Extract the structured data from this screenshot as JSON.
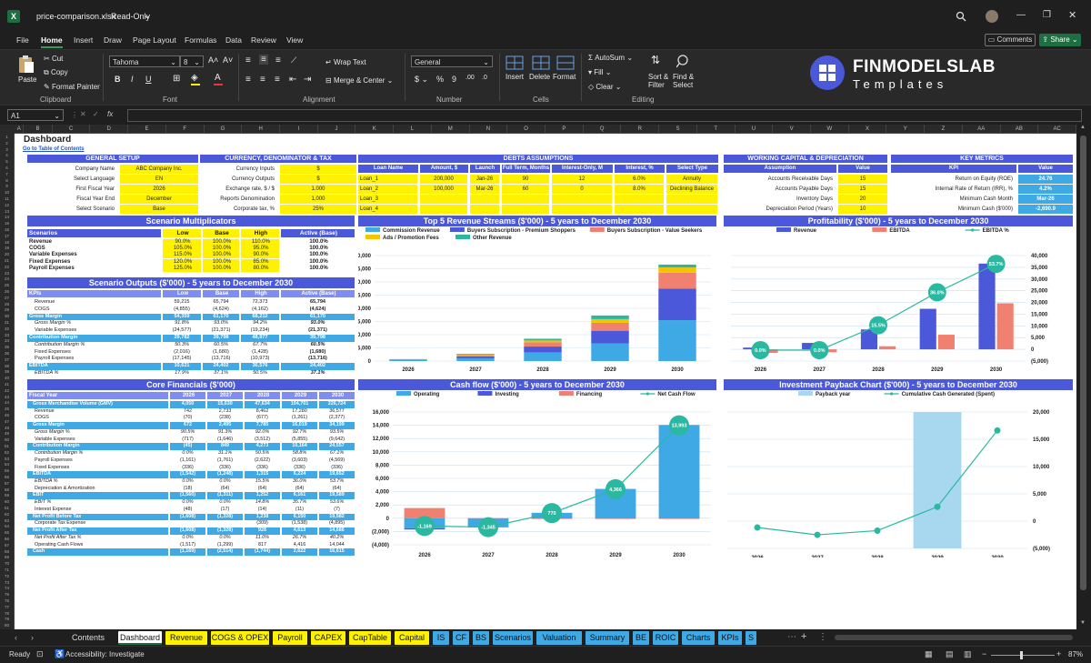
{
  "window": {
    "filename": "price-comparison.xlsx",
    "mode": "Read-Only"
  },
  "menu": [
    "File",
    "Home",
    "Insert",
    "Draw",
    "Page Layout",
    "Formulas",
    "Data",
    "Review",
    "View"
  ],
  "menu_active": "Home",
  "comments_label": "Comments",
  "share_label": "Share",
  "ribbon": {
    "paste": "Paste",
    "cut": "Cut",
    "copy": "Copy",
    "format_painter": "Format Painter",
    "clipboard": "Clipboard",
    "font_name": "Tahoma",
    "font_size": "8",
    "font_group": "Font",
    "wrap_text": "Wrap Text",
    "merge_center": "Merge & Center",
    "alignment": "Alignment",
    "number_format": "General",
    "number_group": "Number",
    "insert": "Insert",
    "delete": "Delete",
    "format": "Format",
    "cells": "Cells",
    "autosum": "AutoSum",
    "fill": "Fill",
    "clear": "Clear",
    "sort_filter": "Sort &\nFilter",
    "find_select": "Find &\nSelect",
    "editing": "Editing"
  },
  "brand": {
    "name": "FINMODELSLAB",
    "sub": "Templates"
  },
  "formula_bar": {
    "name_box": "A1",
    "fx": "fx"
  },
  "columns": [
    "A",
    "B",
    "C",
    "D",
    "E",
    "F",
    "G",
    "H",
    "I",
    "J",
    "K",
    "L",
    "M",
    "N",
    "O",
    "P",
    "Q",
    "R",
    "S",
    "T",
    "U",
    "V",
    "W",
    "X",
    "Y",
    "Z",
    "AA",
    "AB",
    "AC"
  ],
  "sheet": {
    "title": "Dashboard",
    "link": "Go to Table of Contents",
    "general_setup": {
      "title": "GENERAL SETUP",
      "rows": [
        [
          "Company Name",
          "ABC Company Inc."
        ],
        [
          "Select Language",
          "EN"
        ],
        [
          "First Fiscal Year",
          "2026"
        ],
        [
          "Fiscal Year End",
          "December"
        ],
        [
          "Select Scenario",
          "Base"
        ]
      ]
    },
    "currency": {
      "title": "CURRENCY, DENOMINATOR & TAX",
      "rows": [
        [
          "Currency Inputs",
          "$"
        ],
        [
          "Currency Outputs",
          "$"
        ],
        [
          "Exchange rate, $ / $",
          "1.000"
        ],
        [
          "Reports Denomination",
          "1,000"
        ],
        [
          "Corporate tax, %",
          "25%"
        ]
      ]
    },
    "debts": {
      "title": "DEBTS ASSUMPTIONS",
      "headers": [
        "Loan Name",
        "Amount, $",
        "Launch",
        "Full Term, Months",
        "Interest-Only, M",
        "Interest, %",
        "Select Type"
      ],
      "rows": [
        [
          "Loan_1",
          "200,000",
          "Jan-26",
          "90",
          "12",
          "6.0%",
          "Annuity"
        ],
        [
          "Loan_2",
          "100,000",
          "Mar-26",
          "60",
          "0",
          "8.0%",
          "Declining Balance"
        ],
        [
          "Loan_3",
          "",
          "",
          "",
          "",
          "",
          ""
        ],
        [
          "Loan_4",
          "",
          "",
          "",
          "",
          "",
          ""
        ]
      ]
    },
    "wc": {
      "title": "WORKING CAPITAL & DEPRECIATION",
      "headers": [
        "Assumption",
        "Value"
      ],
      "rows": [
        [
          "Accounts Receivable Days",
          "15"
        ],
        [
          "Accounts Payable Days",
          "15"
        ],
        [
          "Inventory Days",
          "20"
        ],
        [
          "Depreciation Period (Years)",
          "10"
        ]
      ]
    },
    "kpi": {
      "title": "KEY METRICS",
      "headers": [
        "KPI",
        "Value"
      ],
      "rows": [
        [
          "Return on Equity (ROE)",
          "24.76"
        ],
        [
          "Internal Rate of Return (IRR), %",
          "4.2%"
        ],
        [
          "Minimum Cash Month",
          "Mar-26"
        ],
        [
          "Minimum Cash ($'000)",
          "-2,690.9"
        ]
      ]
    },
    "scen_mult": {
      "title": "Scenario Multiplicators",
      "headers": [
        "Scenarios",
        "Low",
        "Base",
        "High",
        "Active (Base)"
      ],
      "rows": [
        [
          "Revenue",
          "90.0%",
          "100.0%",
          "110.0%",
          "100.0%"
        ],
        [
          "COGS",
          "105.0%",
          "100.0%",
          "95.0%",
          "100.0%"
        ],
        [
          "Variable Expenses",
          "115.0%",
          "100.0%",
          "90.0%",
          "100.0%"
        ],
        [
          "Fixed Expenses",
          "120.0%",
          "100.0%",
          "85.0%",
          "100.0%"
        ],
        [
          "Payroll Expenses",
          "125.0%",
          "100.0%",
          "80.0%",
          "100.0%"
        ]
      ]
    },
    "scen_out": {
      "title": "Scenario Outputs ($'000) - 5 years to December 2030",
      "headers": [
        "KPIs",
        "Low",
        "Base",
        "High",
        "Active (Base)"
      ],
      "rows": [
        [
          "Revenue",
          "59,215",
          "65,794",
          "72,373",
          "65,794",
          "n"
        ],
        [
          "COGS",
          "(4,855)",
          "(4,624)",
          "(4,162)",
          "(4,624)",
          "n"
        ],
        [
          "Gross Margin",
          "54,359",
          "61,170",
          "68,212",
          "61,170",
          "h"
        ],
        [
          "Gross Margin %",
          "91.8%",
          "93.0%",
          "94.2%",
          "93.0%",
          "i"
        ],
        [
          "Variable Expenses",
          "(24,577)",
          "(21,371)",
          "(19,234)",
          "(21,371)",
          "n"
        ],
        [
          "Contribution Margin",
          "29,782",
          "39,798",
          "48,977",
          "39,798",
          "h"
        ],
        [
          "Contribution Margin %",
          "50.3%",
          "60.5%",
          "67.7%",
          "60.5%",
          "i"
        ],
        [
          "Fixed Expenses",
          "(2,016)",
          "(1,680)",
          "(1,428)",
          "(1,680)",
          "n"
        ],
        [
          "Payroll Expenses",
          "(17,145)",
          "(13,716)",
          "(10,973)",
          "(13,716)",
          "n"
        ],
        [
          "EBITDA",
          "10,621",
          "24,402",
          "36,576",
          "24,402",
          "h"
        ],
        [
          "EBITDA %",
          "17.9%",
          "37.1%",
          "50.5%",
          "37.1%",
          "i"
        ]
      ]
    },
    "core": {
      "title": "Core Financials ($'000)",
      "headers": [
        "Fiscal Year",
        "2026",
        "2027",
        "2028",
        "2029",
        "2030"
      ],
      "rows": [
        [
          "Gross Merchandise Volume (GMV)",
          "4,050",
          "15,630",
          "47,634",
          "104,701",
          "226,724",
          "h"
        ],
        [
          "Revenue",
          "742",
          "2,733",
          "8,462",
          "17,280",
          "36,577",
          "n"
        ],
        [
          "COGS",
          "(70)",
          "(238)",
          "(677)",
          "(1,261)",
          "(2,377)",
          "n"
        ],
        [
          "Gross Margin",
          "672",
          "2,495",
          "7,785",
          "16,019",
          "34,199",
          "h"
        ],
        [
          "Gross Margin %",
          "90.5%",
          "91.3%",
          "92.0%",
          "92.7%",
          "93.5%",
          "i"
        ],
        [
          "Variable Expenses",
          "(717)",
          "(1,646)",
          "(3,512)",
          "(5,855)",
          "(9,642)",
          "n"
        ],
        [
          "Contribution Margin",
          "(45)",
          "849",
          "4,273",
          "10,164",
          "24,557",
          "h"
        ],
        [
          "Contribution Margin %",
          "0.0%",
          "31.1%",
          "50.5%",
          "58.8%",
          "67.1%",
          "i"
        ],
        [
          "Payroll Expenses",
          "(1,161)",
          "(1,761)",
          "(2,622)",
          "(3,603)",
          "(4,569)",
          "n"
        ],
        [
          "Fixed Expenses",
          "(336)",
          "(336)",
          "(336)",
          "(336)",
          "(336)",
          "n"
        ],
        [
          "EBITDA",
          "(1,542)",
          "(1,248)",
          "1,315",
          "6,224",
          "19,652",
          "h"
        ],
        [
          "EBITDA %",
          "0.0%",
          "0.0%",
          "15.5%",
          "36.0%",
          "53.7%",
          "i"
        ],
        [
          "Depreciation & Amortization",
          "(18)",
          "(64)",
          "(64)",
          "(64)",
          "(64)",
          "n"
        ],
        [
          "EBIT",
          "(1,560)",
          "(1,311)",
          "1,252",
          "6,161",
          "19,589",
          "h"
        ],
        [
          "EBIT %",
          "0.0%",
          "0.0%",
          "14.8%",
          "35.7%",
          "53.6%",
          "i"
        ],
        [
          "Interest Expense",
          "(48)",
          "(17)",
          "(14)",
          "(11)",
          "(7)",
          "n"
        ],
        [
          "Net Profit Before Tax",
          "(1,608)",
          "(1,328)",
          "1,238",
          "6,150",
          "19,582",
          "h"
        ],
        [
          "Corporate Tax Expense",
          "",
          "",
          "(309)",
          "(1,538)",
          "(4,895)",
          "n"
        ],
        [
          "Net Profit After Tax",
          "(1,608)",
          "(1,328)",
          "928",
          "4,613",
          "14,686",
          "h"
        ],
        [
          "Net Profit After Tax %",
          "0.0%",
          "0.0%",
          "11.0%",
          "26.7%",
          "40.2%",
          "i"
        ],
        [
          "Operating Cash Flows",
          "(1,517)",
          "(1,299)",
          "817",
          "4,416",
          "14,044",
          "n"
        ],
        [
          "Cash",
          "(1,169)",
          "(2,514)",
          "(1,744)",
          "2,622",
          "16,615",
          "h"
        ]
      ]
    },
    "row_numbers": [
      "1",
      "2",
      "3",
      "4",
      "5",
      "6",
      "7",
      "8",
      "9",
      "10",
      "11",
      "12",
      "13",
      "14",
      "15",
      "16",
      "17",
      "18",
      "19",
      "20",
      "21",
      "22",
      "23",
      "24",
      "25",
      "26",
      "27",
      "28",
      "29",
      "30",
      "31",
      "32",
      "33",
      "34",
      "35",
      "36",
      "37",
      "38",
      "39",
      "40",
      "41",
      "42",
      "43",
      "44",
      "45",
      "46",
      "47",
      "48",
      "49",
      "50",
      "51",
      "52",
      "53",
      "54",
      "55",
      "56",
      "57",
      "58",
      "59",
      "60",
      "61",
      "62",
      "63",
      "64",
      "65",
      "66",
      "67",
      "68",
      "69",
      "70",
      "71",
      "72",
      "73",
      "74",
      "75",
      "76",
      "77",
      "78",
      "79",
      "80"
    ]
  },
  "chart_data": [
    {
      "type": "bar",
      "title": "Top 5 Revenue Streams ($'000) - 5 years to December 2030",
      "categories": [
        "2026",
        "2027",
        "2028",
        "2029",
        "2030"
      ],
      "series": [
        {
          "name": "Commission Revenue",
          "color": "#3fa9e6",
          "values": [
            400,
            1000,
            3300,
            6700,
            15500
          ]
        },
        {
          "name": "Buyers Subscription - Premium Shoppers",
          "color": "#4a58d9",
          "values": [
            170,
            700,
            2200,
            4800,
            12000
          ]
        },
        {
          "name": "Buyers Subscription - Value Seekers",
          "color": "#f08070",
          "values": [
            90,
            500,
            1600,
            3000,
            6000
          ]
        },
        {
          "name": "Ads / Promotion Fees",
          "color": "#f5c400",
          "values": [
            40,
            250,
            700,
            1400,
            2000
          ]
        },
        {
          "name": "Other Revenue",
          "color": "#2ab8a0",
          "values": [
            42,
            283,
            662,
            1380,
            1077
          ]
        }
      ],
      "ylim": [
        0,
        40000
      ],
      "yticks": [
        "0",
        "5,000",
        "10,000",
        "15,000",
        "20,000",
        "25,000",
        "30,000",
        "35,000",
        "40,000"
      ],
      "legend": "top"
    },
    {
      "type": "bar",
      "title": "Profitability ($'000) - 5 years to December 2030",
      "categories": [
        "2026",
        "2027",
        "2028",
        "2029",
        "2030"
      ],
      "series": [
        {
          "name": "Revenue",
          "color": "#4a58d9",
          "values": [
            742,
            2733,
            8462,
            17280,
            36577
          ]
        },
        {
          "name": "EBITDA",
          "color": "#f08070",
          "values": [
            -1542,
            -1248,
            1315,
            6224,
            19652
          ]
        },
        {
          "name": "EBITDA %",
          "color": "#2ab8a0",
          "values": [
            0.0,
            0.0,
            15.5,
            36.0,
            53.7
          ],
          "labels": [
            "0.0%",
            "0.0%",
            "15.5%",
            "36.0%",
            "53.7%"
          ]
        }
      ],
      "ylim": [
        -5000,
        40000
      ],
      "yticks": [
        "(5,000)",
        "0",
        "5,000",
        "10,000",
        "15,000",
        "20,000",
        "25,000",
        "30,000",
        "35,000",
        "40,000"
      ],
      "legend": "top"
    },
    {
      "type": "bar",
      "title": "Cash flow ($'000) - 5 years to December 2030",
      "categories": [
        "2026",
        "2027",
        "2028",
        "2029",
        "2030"
      ],
      "series": [
        {
          "name": "Operating",
          "color": "#3fa9e6",
          "values": [
            -1517,
            -1299,
            817,
            4416,
            14044
          ]
        },
        {
          "name": "Investing",
          "color": "#4a58d9",
          "values": [
            -180,
            -40,
            -40,
            -40,
            -40
          ]
        },
        {
          "name": "Financing",
          "color": "#f08070",
          "values": [
            1528,
            0,
            -7,
            -10,
            -11
          ]
        },
        {
          "name": "Net Cash Flow",
          "color": "#2ab8a0",
          "values": [
            -1169,
            -1345,
            770,
            4366,
            13993
          ],
          "labels": [
            "-1,169",
            "-1,345",
            "770",
            "4,366",
            "13,993"
          ]
        }
      ],
      "ylim": [
        -4000,
        16000
      ],
      "yticks": [
        "(4,000)",
        "(2,000)",
        "0",
        "2,000",
        "4,000",
        "6,000",
        "8,000",
        "10,000",
        "12,000",
        "14,000",
        "16,000"
      ],
      "legend": "top"
    },
    {
      "type": "line",
      "title": "Investment Payback Chart ($'000) - 5 years to December 2030",
      "categories": [
        "2026",
        "2027",
        "2028",
        "2029",
        "2030"
      ],
      "series": [
        {
          "name": "Payback year",
          "color": "#a8d8f0",
          "values": [
            0,
            0,
            0,
            1,
            0
          ]
        },
        {
          "name": "Cumulative Cash Generated (Spent)",
          "color": "#2ab8a0",
          "values": [
            -1169,
            -2514,
            -1744,
            2622,
            16615
          ]
        }
      ],
      "ylim": [
        -5000,
        20000
      ],
      "yticks": [
        "(5,000)",
        "0",
        "5,000",
        "10,000",
        "15,000",
        "20,000"
      ],
      "legend": "top"
    }
  ],
  "tabs": [
    {
      "label": "Contents",
      "color": "#1f1f1f",
      "text": "#ddd"
    },
    {
      "label": "Dashboard",
      "color": "#ffffff",
      "text": "#111",
      "active": true
    },
    {
      "label": "Revenue",
      "color": "#fff200"
    },
    {
      "label": "COGS & OPEX",
      "color": "#fff200"
    },
    {
      "label": "Payroll",
      "color": "#fff200"
    },
    {
      "label": "CAPEX",
      "color": "#fff200"
    },
    {
      "label": "CapTable",
      "color": "#fff200"
    },
    {
      "label": "Capital",
      "color": "#fff200"
    },
    {
      "label": "IS",
      "color": "#3fa9e6"
    },
    {
      "label": "CF",
      "color": "#3fa9e6"
    },
    {
      "label": "BS",
      "color": "#3fa9e6"
    },
    {
      "label": "Scenarios",
      "color": "#3fa9e6"
    },
    {
      "label": "Valuation",
      "color": "#3fa9e6"
    },
    {
      "label": "Summary",
      "color": "#3fa9e6"
    },
    {
      "label": "BE",
      "color": "#3fa9e6"
    },
    {
      "label": "ROIC",
      "color": "#3fa9e6"
    },
    {
      "label": "Charts",
      "color": "#3fa9e6"
    },
    {
      "label": "KPIs",
      "color": "#3fa9e6"
    },
    {
      "label": "S",
      "color": "#3fa9e6"
    }
  ],
  "status": {
    "ready": "Ready",
    "accessibility": "Accessibility: Investigate",
    "zoom": "87%"
  }
}
